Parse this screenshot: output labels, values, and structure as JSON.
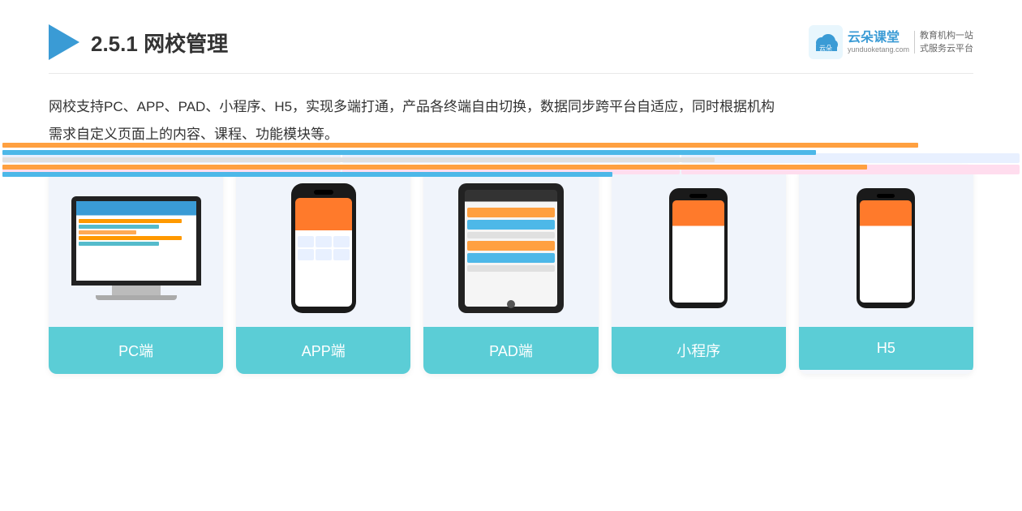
{
  "header": {
    "section_number": "2.5.1",
    "title_plain": "2.5.1 ",
    "title_bold": "网校管理",
    "brand": {
      "name": "云朵课堂",
      "domain": "yunduoketang.com",
      "slogan_line1": "教育机构一站",
      "slogan_line2": "式服务云平台"
    }
  },
  "description": {
    "text_line1": "网校支持PC、APP、PAD、小程序、H5，实现多端打通，产品各终端自由切换，数据同步跨平台自适应，同时根据机构",
    "text_line2": "需求自定义页面上的内容、课程、功能模块等。"
  },
  "cards": [
    {
      "label": "PC端",
      "device": "pc"
    },
    {
      "label": "APP端",
      "device": "phone"
    },
    {
      "label": "PAD端",
      "device": "tablet"
    },
    {
      "label": "小程序",
      "device": "mini-phone"
    },
    {
      "label": "H5",
      "device": "mini-phone2"
    }
  ]
}
